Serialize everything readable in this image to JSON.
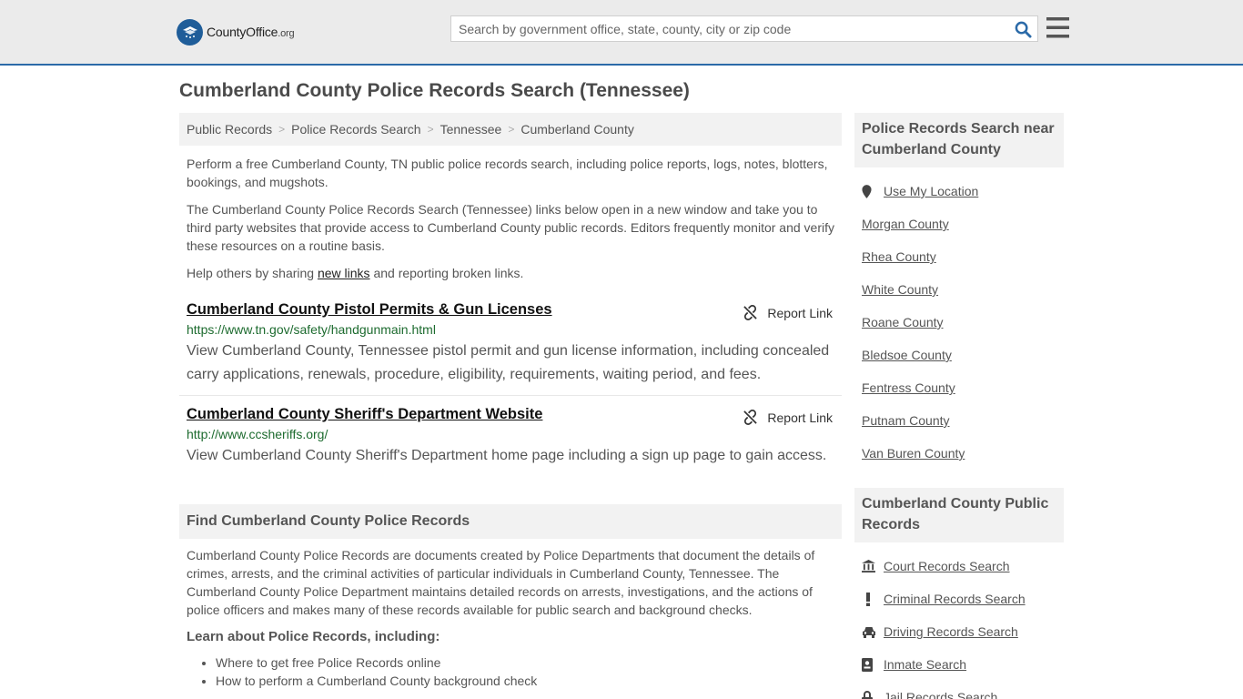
{
  "header": {
    "logo_text_main": "CountyOffice",
    "logo_text_tld": ".org",
    "search_placeholder": "Search by government office, state, county, city or zip code"
  },
  "page_title": "Cumberland County Police Records Search (Tennessee)",
  "breadcrumb": [
    "Public Records",
    "Police Records Search",
    "Tennessee",
    "Cumberland County"
  ],
  "intro": {
    "p1": "Perform a free Cumberland County, TN public police records search, including police reports, logs, notes, blotters, bookings, and mugshots.",
    "p2": "The Cumberland County Police Records Search (Tennessee) links below open in a new window and take you to third party websites that provide access to Cumberland County public records. Editors frequently monitor and verify these resources on a routine basis.",
    "p3_before": "Help others by sharing ",
    "p3_link": "new links",
    "p3_after": " and reporting broken links."
  },
  "report_label": "Report Link",
  "results": [
    {
      "title": "Cumberland County Pistol Permits & Gun Licenses",
      "url": "https://www.tn.gov/safety/handgunmain.html",
      "desc": "View Cumberland County, Tennessee pistol permit and gun license information, including concealed carry applications, renewals, procedure, eligibility, requirements, waiting period, and fees."
    },
    {
      "title": "Cumberland County Sheriff's Department Website",
      "url": "http://www.ccsheriffs.org/",
      "desc": "View Cumberland County Sheriff's Department home page including a sign up page to gain access."
    }
  ],
  "find_section": {
    "title": "Find Cumberland County Police Records",
    "body": "Cumberland County Police Records are documents created by Police Departments that document the details of crimes, arrests, and the criminal activities of particular individuals in Cumberland County, Tennessee. The Cumberland County Police Department maintains detailed records on arrests, investigations, and the actions of police officers and makes many of these records available for public search and background checks.",
    "learn_title": "Learn about Police Records, including:",
    "bullets": [
      "Where to get free Police Records online",
      "How to perform a Cumberland County background check"
    ]
  },
  "sidebar": {
    "nearby_title": "Police Records Search near Cumberland County",
    "use_location": "Use My Location",
    "nearby": [
      "Morgan County",
      "Rhea County",
      "White County",
      "Roane County",
      "Bledsoe County",
      "Fentress County",
      "Putnam County",
      "Van Buren County"
    ],
    "public_title": "Cumberland County Public Records",
    "public": [
      {
        "label": "Court Records Search",
        "icon": "courthouse-icon"
      },
      {
        "label": "Criminal Records Search",
        "icon": "exclamation-icon"
      },
      {
        "label": "Driving Records Search",
        "icon": "car-icon"
      },
      {
        "label": "Inmate Search",
        "icon": "id-badge-icon"
      },
      {
        "label": "Jail Records Search",
        "icon": "lock-icon"
      }
    ]
  }
}
